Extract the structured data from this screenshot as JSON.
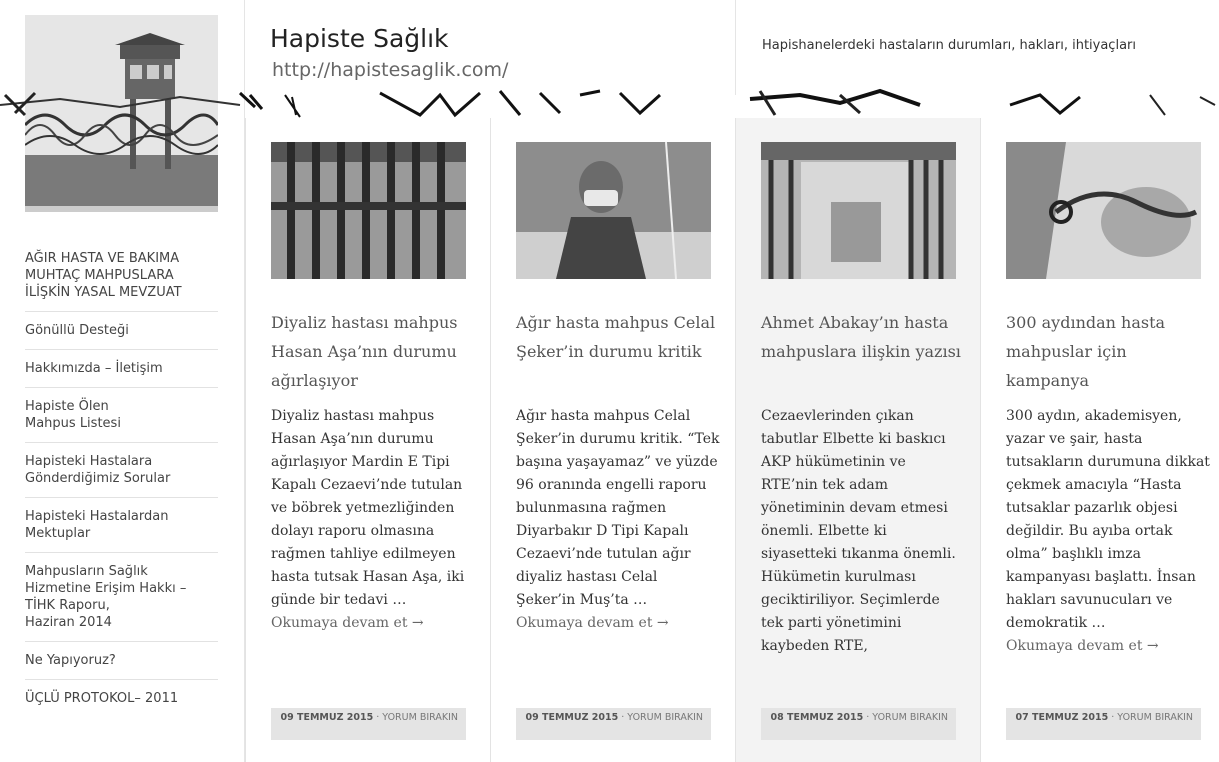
{
  "site": {
    "title": "Hapiste Sağlık",
    "url": "http://hapistesaglik.com/",
    "tagline": "Hapishanelerdeki hastaların durumları, hakları, ihtiyaçları"
  },
  "sidebar": {
    "items": [
      {
        "label": "AĞIR HASTA VE BAKIMA\nMUHTAÇ MAHPUSLARA\nİLİŞKİN YASAL MEVZUAT"
      },
      {
        "label": "Gönüllü Desteği"
      },
      {
        "label": "Hakkımızda – İletişim"
      },
      {
        "label": "Hapiste Ölen\nMahpus Listesi"
      },
      {
        "label": "Hapisteki Hastalara\nGönderdiğimiz Sorular"
      },
      {
        "label": "Hapisteki Hastalardan\nMektuplar"
      },
      {
        "label": "Mahpusların Sağlık\nHizmetine Erişim Hakkı –\nTİHK Raporu,\nHaziran 2014"
      },
      {
        "label": "Ne Yapıyoruz?"
      },
      {
        "label": "ÜÇLÜ PROTOKOL– 2011"
      }
    ]
  },
  "posts": [
    {
      "title": "Diyaliz hastası mahpus Hasan Aşa’nın durumu ağırlaşıyor",
      "excerpt": "Diyaliz hastası mahpus Hasan Aşa’nın durumu ağırlaşıyor Mardin E Tipi Kapalı Cezaevi’nde tutulan ve böbrek yetmezliğinden dolayı raporu olmasına rağmen tahliye edilmeyen hasta tutsak Hasan Aşa, iki günde bir tedavi …",
      "readmore": "Okumaya devam et →",
      "date": "09 TEMMUZ 2015",
      "comment": "YORUM BIRAKIN"
    },
    {
      "title": "Ağır hasta mahpus Celal Şeker’in durumu kritik",
      "excerpt": "Ağır hasta mahpus Celal Şeker’in durumu kritik. “Tek başına yaşayamaz” ve yüzde 96 oranında engelli raporu bulunmasına rağmen Diyarbakır D Tipi Kapalı Cezaevi’nde tutulan ağır diyaliz hastası Celal Şeker’in Muş’ta …",
      "readmore": "Okumaya devam et →",
      "date": "09 TEMMUZ 2015",
      "comment": "YORUM BIRAKIN"
    },
    {
      "title": "Ahmet Abakay’ın hasta mahpuslara ilişkin yazısı",
      "excerpt": "Cezaevlerinden çıkan tabutlar Elbette ki baskıcı AKP hükümetinin ve RTE’nin tek adam yönetiminin devam etmesi önemli. Elbette ki siyasetteki tıkanma önemli. Hükümetin kurulması geciktiriliyor. Seçimlerde tek parti yönetimini kaybeden RTE,",
      "readmore": "",
      "date": "08 TEMMUZ 2015",
      "comment": "YORUM BIRAKIN"
    },
    {
      "title": "300 aydından hasta mahpuslar için kampanya",
      "excerpt": "300 aydın, akademisyen, yazar ve şair, hasta tutsakların durumuna dikkat çekmek amacıyla “Hasta tutsaklar pazarlık objesi değildir. Bu ayıba ortak olma” başlıklı imza kampanyası başlattı. İnsan hakları savunucuları ve demokratik …",
      "readmore": "Okumaya devam et →",
      "date": "07 TEMMUZ 2015",
      "comment": "YORUM BIRAKIN"
    }
  ]
}
